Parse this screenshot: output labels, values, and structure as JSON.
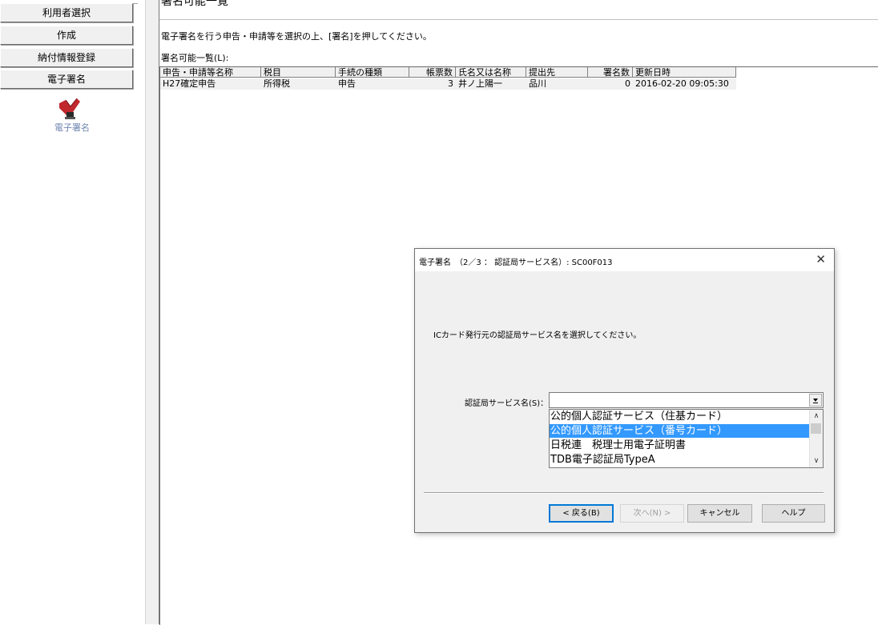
{
  "sidebar": {
    "items": [
      {
        "label": "利用者選択"
      },
      {
        "label": "作成"
      },
      {
        "label": "納付情報登録"
      },
      {
        "label": "電子署名"
      }
    ],
    "icon_label": "電子署名"
  },
  "main": {
    "title": "署名可能一覧",
    "instruction": "電子署名を行う申告・申請等を選択の上、[署名]を押してください。",
    "list_label": "署名可能一覧(L):",
    "table": {
      "columns": [
        "申告・申請等名称",
        "税目",
        "手続の種類",
        "帳票数",
        "氏名又は名称",
        "提出先",
        "署名数",
        "更新日時"
      ],
      "rows": [
        [
          "H27確定申告",
          "所得税",
          "申告",
          "3",
          "井ノ上陽一",
          "品川",
          "0",
          "2016-02-20 09:05:30"
        ]
      ]
    }
  },
  "dialog": {
    "title": "電子署名　（2／3 ： 認証局サービス名）: SC00F013",
    "message": "ICカード発行元の認証局サービス名を選択してください。",
    "field_label": "認証局サービス名(S)：",
    "combo_value": "",
    "options": [
      "公的個人認証サービス（住基カード）",
      "公的個人認証サービス（番号カード）",
      "日税連　税理士用電子証明書",
      "TDB電子認証局TypeA"
    ],
    "selected_index": 1,
    "buttons": {
      "back": "< 戻る(B)",
      "next": "次へ(N) >",
      "cancel": "キャンセル",
      "help": "ヘルプ"
    },
    "close_glyph": "✕"
  },
  "colors": {
    "selection": "#3399ff",
    "icon_label": "#6f86b0",
    "default_button_border": "#0078d7"
  }
}
